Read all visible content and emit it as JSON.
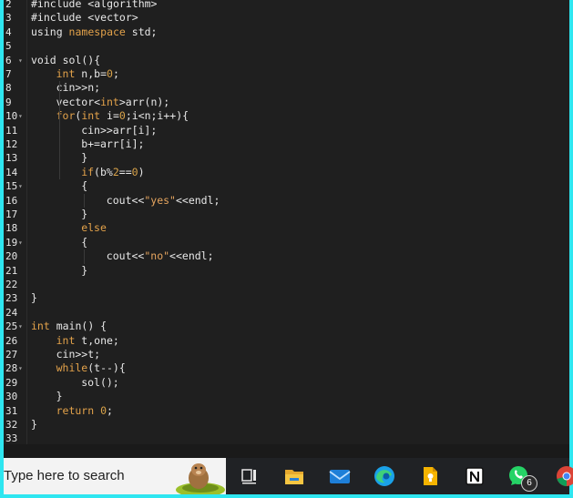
{
  "editor": {
    "lines": [
      {
        "n": "2",
        "fold": false,
        "indent": 0,
        "tokens": [
          [
            "#include <algorithm>",
            "plain"
          ]
        ]
      },
      {
        "n": "3",
        "fold": false,
        "indent": 0,
        "tokens": [
          [
            "#include <vector>",
            "plain"
          ]
        ]
      },
      {
        "n": "4",
        "fold": false,
        "indent": 0,
        "tokens": [
          [
            "using ",
            "plain"
          ],
          [
            "namespace",
            "kw"
          ],
          [
            " std;",
            "plain"
          ]
        ]
      },
      {
        "n": "5",
        "fold": false,
        "indent": 0,
        "tokens": []
      },
      {
        "n": "6",
        "fold": true,
        "indent": 0,
        "tokens": [
          [
            "void sol(){",
            "plain"
          ]
        ]
      },
      {
        "n": "7",
        "fold": false,
        "indent": 1,
        "tokens": [
          [
            "int",
            "kw"
          ],
          [
            " n,b=",
            "plain"
          ],
          [
            "0",
            "num"
          ],
          [
            ";",
            "plain"
          ]
        ]
      },
      {
        "n": "8",
        "fold": false,
        "indent": 1,
        "tokens": [
          [
            "cin>>n;",
            "plain"
          ]
        ]
      },
      {
        "n": "9",
        "fold": false,
        "indent": 1,
        "tokens": [
          [
            "vector<",
            "plain"
          ],
          [
            "int",
            "kw"
          ],
          [
            ">arr(n);",
            "plain"
          ]
        ]
      },
      {
        "n": "10",
        "fold": true,
        "indent": 1,
        "tokens": [
          [
            "for",
            "kw"
          ],
          [
            "(",
            "plain"
          ],
          [
            "int",
            "kw"
          ],
          [
            " i=",
            "plain"
          ],
          [
            "0",
            "num"
          ],
          [
            ";i<n;i++){",
            "plain"
          ]
        ]
      },
      {
        "n": "11",
        "fold": false,
        "indent": 2,
        "tokens": [
          [
            "cin>>arr[i];",
            "plain"
          ]
        ]
      },
      {
        "n": "12",
        "fold": false,
        "indent": 2,
        "tokens": [
          [
            "b+=arr[i];",
            "plain"
          ]
        ]
      },
      {
        "n": "13",
        "fold": false,
        "indent": 2,
        "tokens": [
          [
            "}",
            "plain"
          ]
        ]
      },
      {
        "n": "14",
        "fold": false,
        "indent": 2,
        "tokens": [
          [
            "if",
            "kw"
          ],
          [
            "(b%",
            "plain"
          ],
          [
            "2",
            "num"
          ],
          [
            "==",
            "plain"
          ],
          [
            "0",
            "num"
          ],
          [
            ")",
            "plain"
          ]
        ]
      },
      {
        "n": "15",
        "fold": true,
        "indent": 2,
        "tokens": [
          [
            "{",
            "plain"
          ]
        ]
      },
      {
        "n": "16",
        "fold": false,
        "indent": 3,
        "tokens": [
          [
            "cout<<",
            "plain"
          ],
          [
            "\"yes\"",
            "str"
          ],
          [
            "<<endl;",
            "plain"
          ]
        ]
      },
      {
        "n": "17",
        "fold": false,
        "indent": 2,
        "tokens": [
          [
            "}",
            "plain"
          ]
        ]
      },
      {
        "n": "18",
        "fold": false,
        "indent": 2,
        "tokens": [
          [
            "else",
            "kw"
          ]
        ]
      },
      {
        "n": "19",
        "fold": true,
        "indent": 2,
        "tokens": [
          [
            "{",
            "plain"
          ]
        ]
      },
      {
        "n": "20",
        "fold": false,
        "indent": 3,
        "tokens": [
          [
            "cout<<",
            "plain"
          ],
          [
            "\"no\"",
            "str"
          ],
          [
            "<<endl;",
            "plain"
          ]
        ]
      },
      {
        "n": "21",
        "fold": false,
        "indent": 2,
        "tokens": [
          [
            "}",
            "plain"
          ]
        ]
      },
      {
        "n": "22",
        "fold": false,
        "indent": 0,
        "tokens": []
      },
      {
        "n": "23",
        "fold": false,
        "indent": 0,
        "tokens": [
          [
            "}",
            "plain"
          ]
        ]
      },
      {
        "n": "24",
        "fold": false,
        "indent": 0,
        "tokens": []
      },
      {
        "n": "25",
        "fold": true,
        "indent": 0,
        "tokens": [
          [
            "int",
            "kw"
          ],
          [
            " main() {",
            "plain"
          ]
        ]
      },
      {
        "n": "26",
        "fold": false,
        "indent": 1,
        "tokens": [
          [
            "int",
            "kw"
          ],
          [
            " t,one;",
            "plain"
          ]
        ]
      },
      {
        "n": "27",
        "fold": false,
        "indent": 1,
        "tokens": [
          [
            "cin>>t;",
            "plain"
          ]
        ]
      },
      {
        "n": "28",
        "fold": true,
        "indent": 1,
        "tokens": [
          [
            "while",
            "kw"
          ],
          [
            "(t--){",
            "plain"
          ]
        ]
      },
      {
        "n": "29",
        "fold": false,
        "indent": 2,
        "tokens": [
          [
            "sol();",
            "plain"
          ]
        ]
      },
      {
        "n": "30",
        "fold": false,
        "indent": 1,
        "tokens": [
          [
            "}",
            "plain"
          ]
        ]
      },
      {
        "n": "31",
        "fold": false,
        "indent": 1,
        "tokens": [
          [
            "return",
            "kw"
          ],
          [
            " ",
            "plain"
          ],
          [
            "0",
            "num"
          ],
          [
            ";",
            "plain"
          ]
        ]
      },
      {
        "n": "32",
        "fold": false,
        "indent": 0,
        "tokens": [
          [
            "}",
            "plain"
          ]
        ]
      },
      {
        "n": "33",
        "fold": false,
        "indent": 0,
        "tokens": []
      }
    ]
  },
  "taskbar": {
    "search_text": "Type here to search",
    "icons": [
      "task-view-icon",
      "file-explorer-icon",
      "mail-icon",
      "edge-icon",
      "keep-icon",
      "notion-icon",
      "whatsapp-icon",
      "chrome-icon"
    ],
    "whatsapp_badge": "6"
  }
}
